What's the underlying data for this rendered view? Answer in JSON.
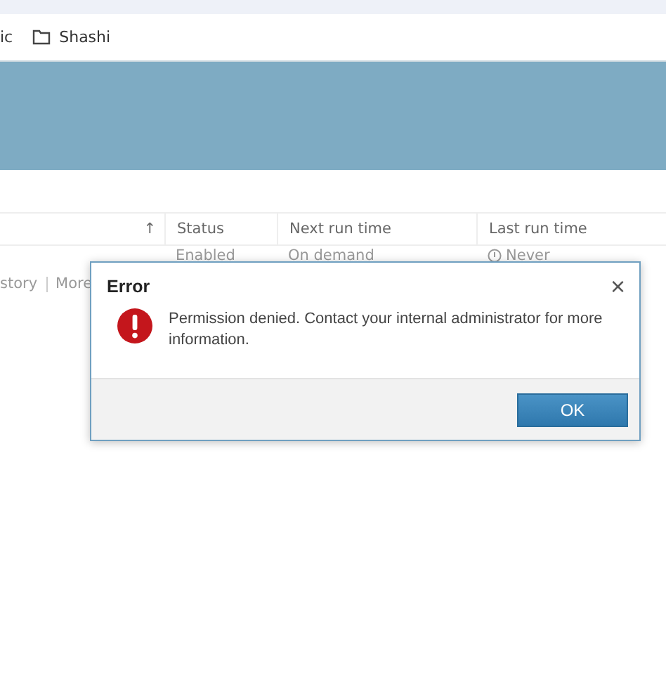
{
  "bookmarks": [
    {
      "label": "ic",
      "kind": "text"
    },
    {
      "label": "Shashi",
      "kind": "folder"
    }
  ],
  "table": {
    "columns": [
      {
        "label": "↑"
      },
      {
        "label": "Status"
      },
      {
        "label": "Next run time"
      },
      {
        "label": "Last run time"
      }
    ],
    "rows": [
      {
        "status": "Enabled",
        "next_run": "On demand",
        "last_run": "Never"
      }
    ]
  },
  "links": [
    "story",
    "More"
  ],
  "dialog": {
    "title": "Error",
    "close": "×",
    "message": "Permission denied. Contact your internal administrator for more information.",
    "buttons": [
      "OK"
    ]
  }
}
